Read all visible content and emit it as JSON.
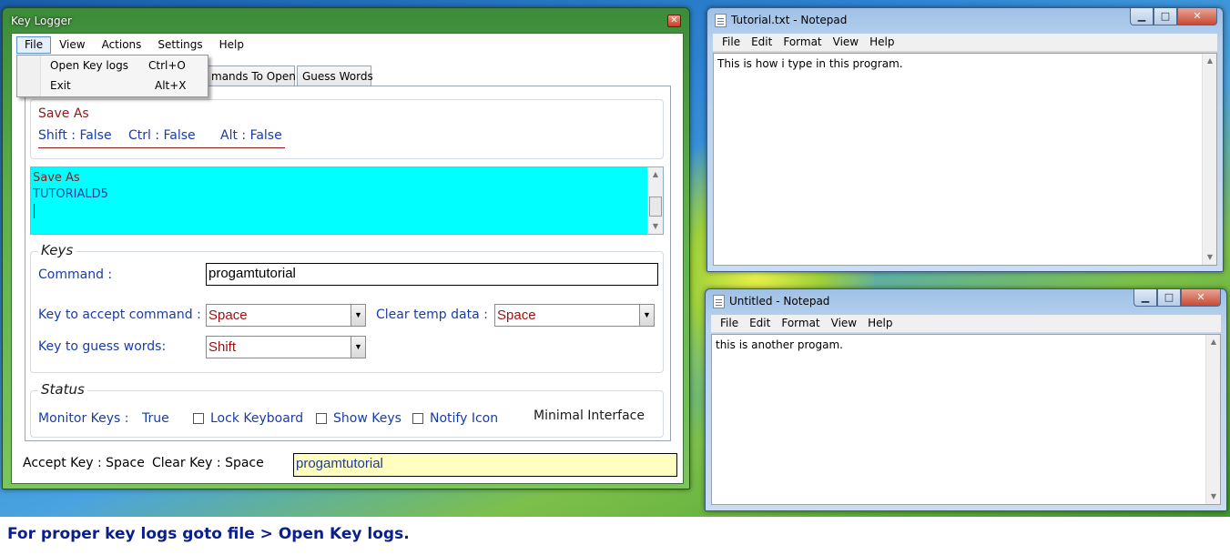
{
  "caption": "For proper key logs goto file > Open Key logs.",
  "notepad1": {
    "title": "Tutorial.txt - Notepad",
    "menu": [
      "File",
      "Edit",
      "Format",
      "View",
      "Help"
    ],
    "text": "This is how i type in this program."
  },
  "notepad2": {
    "title": "Untitled - Notepad",
    "menu": [
      "File",
      "Edit",
      "Format",
      "View",
      "Help"
    ],
    "text": "this is another progam."
  },
  "keylogger": {
    "title": "Key Logger",
    "menu": [
      "File",
      "View",
      "Actions",
      "Settings",
      "Help"
    ],
    "file_menu": [
      {
        "label": "Open Key logs",
        "shortcut": "Ctrl+O"
      },
      {
        "label": "Exit",
        "shortcut": "Alt+X"
      }
    ],
    "tabs": [
      "mands To Open",
      "Guess Words"
    ],
    "top_group": {
      "line1": "Save As",
      "shift": "Shift : False",
      "ctrl": "Ctrl : False",
      "alt": "Alt : False"
    },
    "log_lines": [
      "Save As",
      "TUTORIALD5"
    ],
    "keys": {
      "title": "Keys",
      "command_label": "Command :",
      "command_value": "progamtutorial",
      "accept_label": "Key to accept command :",
      "accept_value": "Space",
      "clear_label": "Clear temp data :",
      "clear_value": "Space",
      "guess_label": "Key to guess words:",
      "guess_value": "Shift"
    },
    "status": {
      "title": "Status",
      "monitor_label": "Monitor Keys :",
      "monitor_value": "True",
      "lock_keyboard": "Lock Keyboard",
      "show_keys": "Show Keys",
      "notify_icon": "Notify Icon",
      "minimal_interface": "Minimal Interface"
    },
    "footer": {
      "accept_key": "Accept Key : Space",
      "clear_key": "Clear Key : Space",
      "current": "progamtutorial"
    }
  }
}
